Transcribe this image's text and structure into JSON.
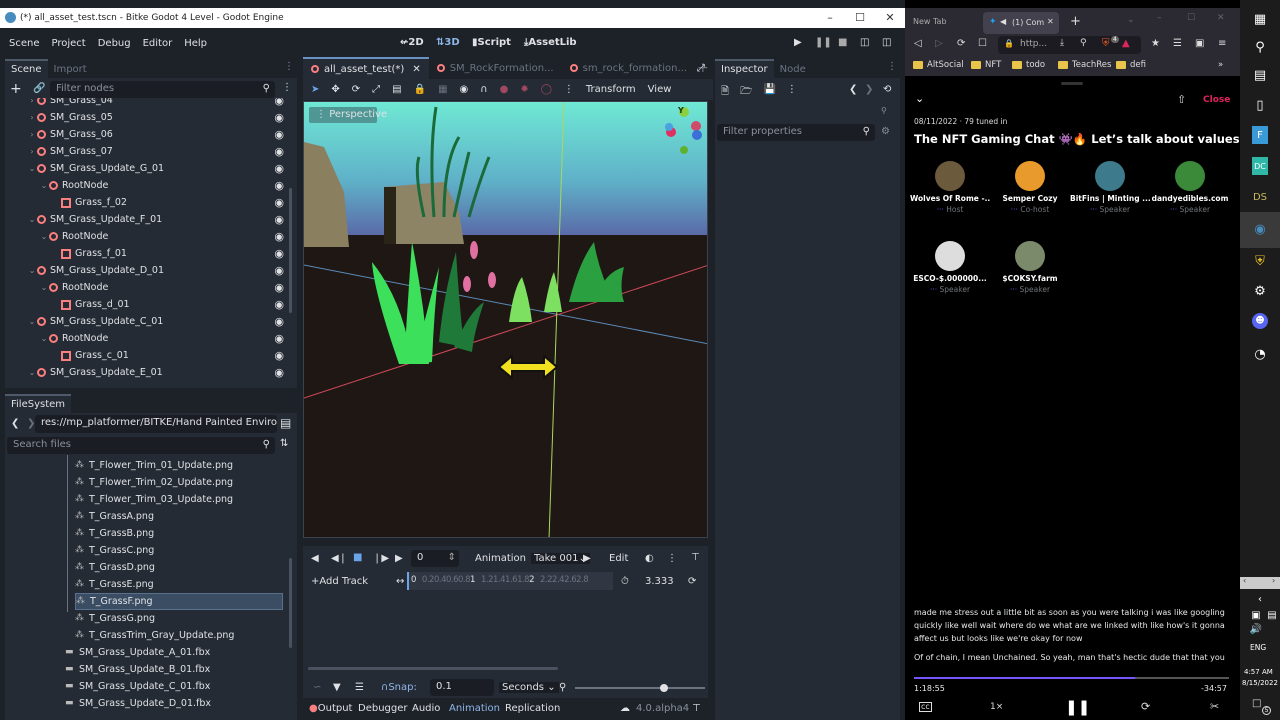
{
  "godot": {
    "window_title": "(*) all_asset_test.tscn - Bitke Godot 4 Level - Godot Engine",
    "menus": [
      "Scene",
      "Project",
      "Debug",
      "Editor",
      "Help"
    ],
    "workspaces": {
      "w2d": "2D",
      "w3d": "3D",
      "script": "Script",
      "assetlib": "AssetLib"
    },
    "scene_dock": {
      "tabs": [
        "Scene",
        "Import"
      ],
      "filter_placeholder": "Filter nodes",
      "nodes": [
        {
          "name": "SM_Grass_04",
          "type": "node",
          "depth": 0,
          "expand": "collapsed"
        },
        {
          "name": "SM_Grass_05",
          "type": "node",
          "depth": 0,
          "expand": "collapsed"
        },
        {
          "name": "SM_Grass_06",
          "type": "node",
          "depth": 0,
          "expand": "collapsed"
        },
        {
          "name": "SM_Grass_07",
          "type": "node",
          "depth": 0,
          "expand": "collapsed"
        },
        {
          "name": "SM_Grass_Update_G_01",
          "type": "node",
          "depth": 0,
          "expand": "expanded"
        },
        {
          "name": "RootNode",
          "type": "node",
          "depth": 1,
          "expand": "expanded"
        },
        {
          "name": "Grass_f_02",
          "type": "mesh",
          "depth": 2,
          "expand": "none"
        },
        {
          "name": "SM_Grass_Update_F_01",
          "type": "node",
          "depth": 0,
          "expand": "expanded"
        },
        {
          "name": "RootNode",
          "type": "node",
          "depth": 1,
          "expand": "expanded"
        },
        {
          "name": "Grass_f_01",
          "type": "mesh",
          "depth": 2,
          "expand": "none"
        },
        {
          "name": "SM_Grass_Update_D_01",
          "type": "node",
          "depth": 0,
          "expand": "expanded"
        },
        {
          "name": "RootNode",
          "type": "node",
          "depth": 1,
          "expand": "expanded"
        },
        {
          "name": "Grass_d_01",
          "type": "mesh",
          "depth": 2,
          "expand": "none"
        },
        {
          "name": "SM_Grass_Update_C_01",
          "type": "node",
          "depth": 0,
          "expand": "expanded"
        },
        {
          "name": "RootNode",
          "type": "node",
          "depth": 1,
          "expand": "expanded"
        },
        {
          "name": "Grass_c_01",
          "type": "mesh",
          "depth": 2,
          "expand": "none"
        },
        {
          "name": "SM_Grass_Update_E_01",
          "type": "node",
          "depth": 0,
          "expand": "expanded"
        }
      ]
    },
    "filesystem": {
      "tab": "FileSystem",
      "path": "res://mp_platformer/BITKE/Hand Painted Environme",
      "search_placeholder": "Search files",
      "files": [
        {
          "name": "T_Flower_Trim_01_Update.png",
          "kind": "texture",
          "indent": 1
        },
        {
          "name": "T_Flower_Trim_02_Update.png",
          "kind": "texture",
          "indent": 1
        },
        {
          "name": "T_Flower_Trim_03_Update.png",
          "kind": "texture",
          "indent": 1
        },
        {
          "name": "T_GrassA.png",
          "kind": "texture",
          "indent": 1
        },
        {
          "name": "T_GrassB.png",
          "kind": "texture",
          "indent": 1
        },
        {
          "name": "T_GrassC.png",
          "kind": "texture",
          "indent": 1
        },
        {
          "name": "T_GrassD.png",
          "kind": "texture",
          "indent": 1
        },
        {
          "name": "T_GrassE.png",
          "kind": "texture",
          "indent": 1
        },
        {
          "name": "T_GrassF.png",
          "kind": "texture",
          "indent": 1,
          "selected": true
        },
        {
          "name": "T_GrassG.png",
          "kind": "texture",
          "indent": 1
        },
        {
          "name": "T_GrassTrim_Gray_Update.png",
          "kind": "texture",
          "indent": 1
        },
        {
          "name": "SM_Grass_Update_A_01.fbx",
          "kind": "scene",
          "indent": 0
        },
        {
          "name": "SM_Grass_Update_B_01.fbx",
          "kind": "scene",
          "indent": 0
        },
        {
          "name": "SM_Grass_Update_C_01.fbx",
          "kind": "scene",
          "indent": 0
        },
        {
          "name": "SM_Grass_Update_D_01.fbx",
          "kind": "scene",
          "indent": 0
        }
      ]
    },
    "editor_tabs": [
      "all_asset_test(*)",
      "SM_RockFormation...",
      "sm_rock_formation..."
    ],
    "viewport": {
      "toolbar_menus": {
        "transform": "Transform",
        "view": "View"
      },
      "perspective_label": "Perspective",
      "gizmo_axis_y": "Y"
    },
    "inspector": {
      "tabs": [
        "Inspector",
        "Node"
      ],
      "filter_placeholder": "Filter properties"
    },
    "animation": {
      "frame_value": "0",
      "animation_menu": "Animation",
      "current_animation": "Take 001",
      "edit_label": "Edit",
      "add_track": "Add Track",
      "timeline_ticks": [
        "0",
        "0.2",
        "0.4",
        "0.6",
        "0.8",
        "1",
        "1.2",
        "1.4",
        "1.6",
        "1.8",
        "2",
        "2.2",
        "2.4",
        "2.6",
        "2.8"
      ],
      "length": "3.333",
      "snap_label": "Snap:",
      "snap_value": "0.1",
      "snap_unit": "Seconds",
      "zoom_fraction": 0.65
    },
    "bottom_tabs": [
      "Output",
      "Debugger",
      "Audio",
      "Animation",
      "Replication"
    ],
    "active_bottom_tab": "Animation",
    "version": "4.0.alpha4"
  },
  "browser": {
    "tabs": [
      {
        "label": "New Tab",
        "active": false
      },
      {
        "label": "(1) Com",
        "active": true
      }
    ],
    "url": "http...",
    "shield_badge": "4",
    "bookmarks": [
      "AltSocial",
      "NFT",
      "todo",
      "TeachRes",
      "defi"
    ],
    "space": {
      "close_label": "Close",
      "meta": "08/11/2022 · 79 tuned in",
      "title": "The NFT Gaming Chat 👾🔥 Let’s talk about values!",
      "speakers": [
        {
          "name": "Wolves Of Rome -...",
          "role": "Host",
          "color": "#6b5a3c"
        },
        {
          "name": "Semper Cozy",
          "role": "Co-host",
          "color": "#e89a2c"
        },
        {
          "name": "BitFins | Minting ...",
          "role": "Speaker",
          "color": "#3c7a8c"
        },
        {
          "name": "dandyedibles.com",
          "role": "Speaker",
          "color": "#3a8a3a"
        },
        {
          "name": "ESCO-$.000000...",
          "role": "Speaker",
          "color": "#dddddd"
        },
        {
          "name": "$COKSY.farm",
          "role": "Speaker",
          "color": "#7a8a6a"
        }
      ],
      "transcript": [
        "made me stress out a little bit as soon as you were talking i was like googling quickly like well wait where do we what are we linked with like how's it gonna affect us but looks like we're okay for now",
        "Of of chain, I mean Unchained. So yeah, man that's hectic dude that that you"
      ],
      "elapsed": "1:18:55",
      "remaining": "-34:57",
      "progress_fraction": 0.7,
      "speed": "1×"
    }
  },
  "taskbar": {
    "language": "ENG",
    "time": "4:57 AM",
    "date": "8/15/2022",
    "notification_count": "5"
  }
}
